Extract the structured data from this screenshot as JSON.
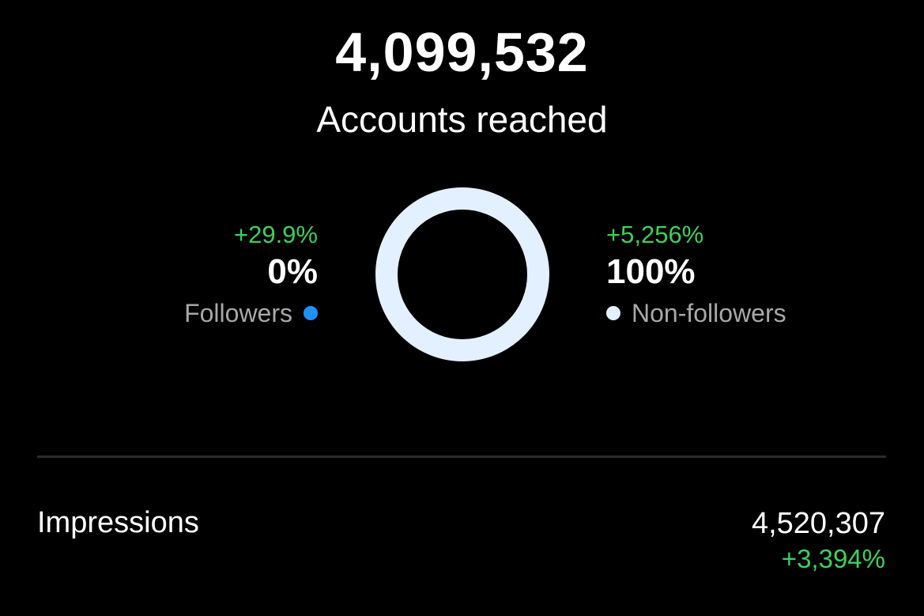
{
  "reach": {
    "total": "4,099,532",
    "label": "Accounts reached"
  },
  "followers": {
    "delta": "+29.9%",
    "share": "0%",
    "label": "Followers",
    "color": "#1e90ff",
    "fraction": 0.0
  },
  "non_followers": {
    "delta": "+5,256%",
    "share": "100%",
    "label": "Non-followers",
    "color": "#e3f0ff",
    "fraction": 1.0
  },
  "impressions": {
    "label": "Impressions",
    "value": "4,520,307",
    "delta": "+3,394%"
  },
  "colors": {
    "background": "#000000",
    "positive": "#3dd05c",
    "muted_text": "#a8a8a8",
    "divider": "#2a2a2a"
  }
}
